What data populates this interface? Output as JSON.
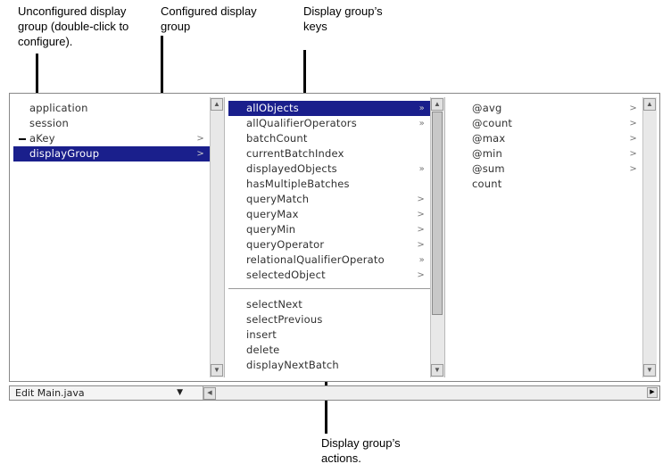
{
  "callouts": {
    "unconfigured": "Unconfigured display group (double-click to configure).",
    "configured": "Configured display group",
    "keys": "Display group’s keys",
    "actions": "Display group’s actions."
  },
  "column1": {
    "items": [
      {
        "label": "application",
        "arrow": ""
      },
      {
        "label": "session",
        "arrow": ""
      },
      {
        "label": "aKey",
        "arrow": ">"
      },
      {
        "label": "displayGroup",
        "arrow": ">"
      }
    ],
    "selected_index": 3
  },
  "column2": {
    "keys": [
      {
        "label": "allObjects",
        "arrow": "»"
      },
      {
        "label": "allQualifierOperators",
        "arrow": "»"
      },
      {
        "label": "batchCount",
        "arrow": ""
      },
      {
        "label": "currentBatchIndex",
        "arrow": ""
      },
      {
        "label": "displayedObjects",
        "arrow": "»"
      },
      {
        "label": "hasMultipleBatches",
        "arrow": ""
      },
      {
        "label": "queryMatch",
        "arrow": ">"
      },
      {
        "label": "queryMax",
        "arrow": ">"
      },
      {
        "label": "queryMin",
        "arrow": ">"
      },
      {
        "label": "queryOperator",
        "arrow": ">"
      },
      {
        "label": "relationalQualifierOperato",
        "arrow": "»"
      },
      {
        "label": "selectedObject",
        "arrow": ">"
      }
    ],
    "actions": [
      {
        "label": "selectNext"
      },
      {
        "label": "selectPrevious"
      },
      {
        "label": "insert"
      },
      {
        "label": "delete"
      },
      {
        "label": "displayNextBatch"
      }
    ],
    "selected_index": 0
  },
  "column3": {
    "items": [
      {
        "label": "@avg",
        "arrow": ">"
      },
      {
        "label": "@count",
        "arrow": ">"
      },
      {
        "label": "@max",
        "arrow": ">"
      },
      {
        "label": "@min",
        "arrow": ">"
      },
      {
        "label": "@sum",
        "arrow": ">"
      },
      {
        "label": "count",
        "arrow": ""
      }
    ]
  },
  "bottom": {
    "file_popup": "Edit Main.java"
  },
  "icons": {
    "scroll_up": "scroll-up-arrow-icon",
    "scroll_down": "scroll-down-arrow-icon",
    "popup_caret": "caret-down-icon"
  },
  "colors": {
    "selection": "#1a1f8c"
  }
}
